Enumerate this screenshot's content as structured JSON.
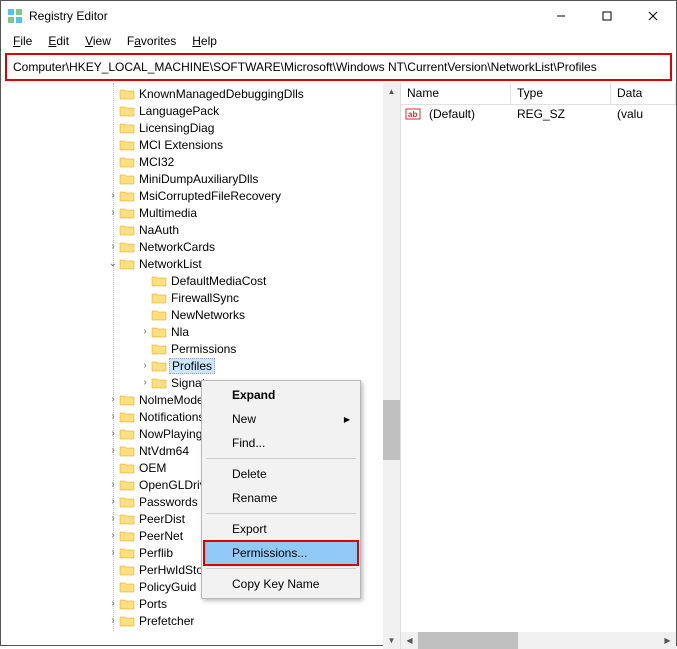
{
  "window": {
    "title": "Registry Editor"
  },
  "menu": {
    "file": "File",
    "edit": "Edit",
    "view": "View",
    "favorites": "Favorites",
    "help": "Help"
  },
  "address": "Computer\\HKEY_LOCAL_MACHINE\\SOFTWARE\\Microsoft\\Windows NT\\CurrentVersion\\NetworkList\\Profiles",
  "tree": {
    "items_a": [
      "KnownManagedDebuggingDlls",
      "LanguagePack",
      "LicensingDiag",
      "MCI Extensions",
      "MCI32",
      "MiniDumpAuxiliaryDlls",
      "MsiCorruptedFileRecovery",
      "Multimedia",
      "NaAuth",
      "NetworkCards"
    ],
    "networklist": "NetworkList",
    "items_c": [
      "DefaultMediaCost",
      "FirewallSync",
      "NewNetworks",
      "Nla",
      "Permissions"
    ],
    "profiles": "Profiles",
    "signatures": "Signatures",
    "items_a2": [
      "NolmeModes",
      "Notifications",
      "NowPlaying",
      "NtVdm64",
      "OEM",
      "OpenGLDrivers",
      "Passwords",
      "PeerDist",
      "PeerNet",
      "Perflib",
      "PerHwIdStorage",
      "PolicyGuid",
      "Ports",
      "Prefetcher"
    ],
    "expanders": {
      "MsiCorruptedFileRecovery": true,
      "Multimedia": true,
      "NetworkCards": true,
      "Nla": true,
      "NolmeModes": true,
      "Notifications": true,
      "NowPlaying": true,
      "NtVdm64": true,
      "OpenGLDrivers": true,
      "Passwords": true,
      "PeerDist": true,
      "PeerNet": true,
      "Perflib": true,
      "Ports": true,
      "Prefetcher": true,
      "Signatures": true,
      "Profiles": true
    }
  },
  "list": {
    "headers": {
      "name": "Name",
      "type": "Type",
      "data": "Data"
    },
    "rows": [
      {
        "name": "(Default)",
        "type": "REG_SZ",
        "data": "(valu"
      }
    ]
  },
  "ctx": {
    "expand": "Expand",
    "new": "New",
    "find": "Find...",
    "delete": "Delete",
    "rename": "Rename",
    "export": "Export",
    "permissions": "Permissions...",
    "copy": "Copy Key Name"
  }
}
